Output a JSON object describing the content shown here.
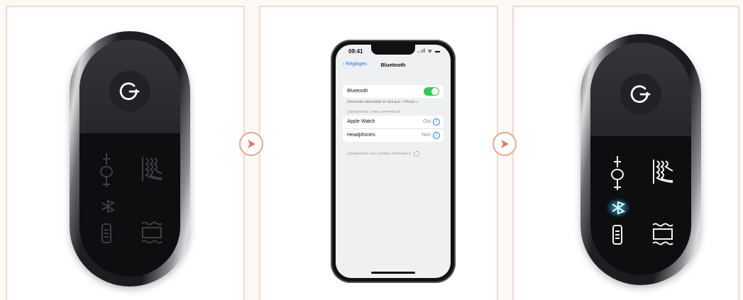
{
  "colors": {
    "panel_border": "#f3d9cf",
    "arrow": "#e8a68c",
    "toggle_on": "#34c759",
    "link": "#1a73e8",
    "led_glow": "#3ad0ff"
  },
  "phone": {
    "status_time": "09:41",
    "status_icons": "..ıl ᯤ ▬",
    "nav_back": "Réglages",
    "nav_title": "Bluetooth",
    "bluetooth_label": "Bluetooth",
    "bluetooth_on": true,
    "discoverable_text": "Désormais détectable en tant que « iPhone ».",
    "my_devices_header": "CONNEXION À MES APPAREILS",
    "devices": [
      {
        "name": "Apple Watch",
        "status": "Oui"
      },
      {
        "name": "Headphones",
        "status": "Non"
      }
    ],
    "other_devices_header": "CONNEXION AUX AUTRES APPAREILS"
  },
  "icons": [
    "power-icon",
    "temperature-icon",
    "heat-waves-icon",
    "bluetooth-icon",
    "battery-icon",
    "heating-pad-icon",
    "next-arrow-icon"
  ]
}
